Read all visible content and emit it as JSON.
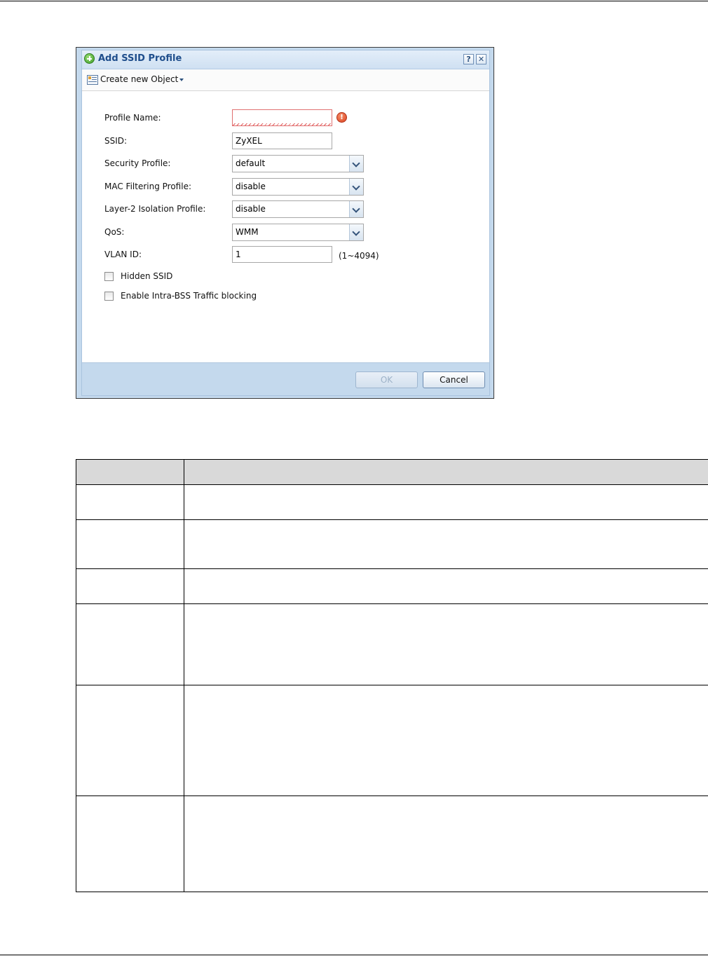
{
  "dialog": {
    "title": "Add SSID Profile",
    "help_label": "?",
    "close_label": "✕",
    "toolbar": {
      "create_object_label": "Create new Object"
    },
    "form": {
      "profile_name_label": "Profile Name:",
      "profile_name_value": "",
      "error_glyph": "!",
      "ssid_label": "SSID:",
      "ssid_value": "ZyXEL",
      "security_profile_label": "Security Profile:",
      "security_profile_value": "default",
      "mac_filtering_label": "MAC Filtering Profile:",
      "mac_filtering_value": "disable",
      "layer2_isolation_label": "Layer-2 Isolation Profile:",
      "layer2_isolation_value": "disable",
      "qos_label": "QoS:",
      "qos_value": "WMM",
      "vlan_id_label": "VLAN ID:",
      "vlan_id_value": "1",
      "vlan_id_range": "(1~4094)",
      "hidden_ssid_label": "Hidden SSID",
      "hidden_ssid_checked": false,
      "intra_bss_label": "Enable Intra-BSS Traffic blocking",
      "intra_bss_checked": false
    },
    "buttons": {
      "ok_label": "OK",
      "ok_enabled": false,
      "cancel_label": "Cancel"
    }
  },
  "table": {
    "header": [
      "",
      ""
    ],
    "row_count": 6
  },
  "colors": {
    "title_text": "#1f4e8c",
    "dialog_frame": "#c4d9ed",
    "error": "#d9401d",
    "table_header": "#d9d9d9"
  }
}
